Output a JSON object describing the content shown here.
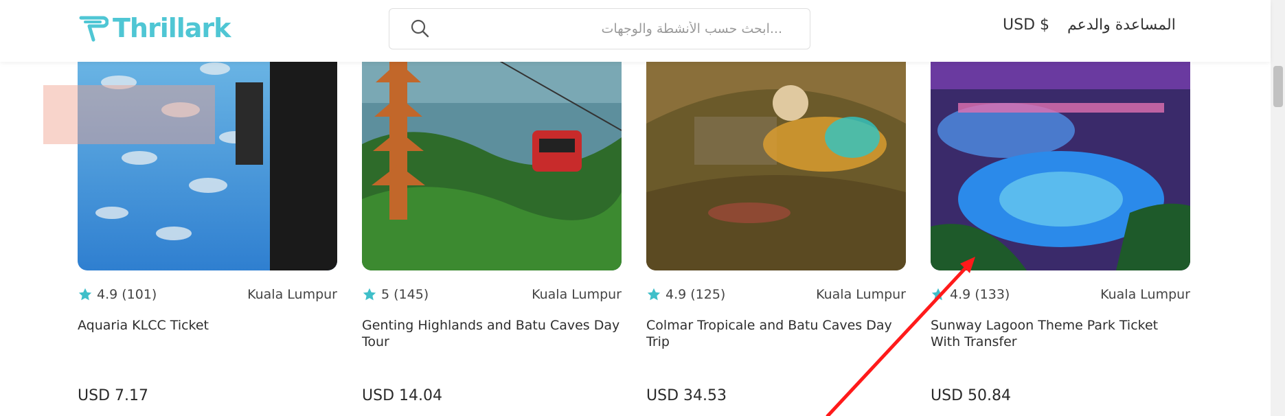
{
  "header": {
    "logo_text": "Thrillark",
    "search_placeholder": "...ابحث حسب الأنشطة والوجهات",
    "currency": "USD $",
    "help": "المساعدة والدعم"
  },
  "cards": [
    {
      "rating": "4.9 (101)",
      "location": "Kuala Lumpur",
      "title": "Aquaria KLCC Ticket",
      "price": "USD 7.17"
    },
    {
      "rating": "5 (145)",
      "location": "Kuala Lumpur",
      "title": "Genting Highlands and Batu Caves Day Tour",
      "price": "USD 14.04"
    },
    {
      "rating": "4.9 (125)",
      "location": "Kuala Lumpur",
      "title": "Colmar Tropicale and Batu Caves Day Trip",
      "price": "USD 34.53"
    },
    {
      "rating": "4.9 (133)",
      "location": "Kuala Lumpur",
      "title": "Sunway Lagoon Theme Park Ticket With Transfer",
      "price": "USD 50.84"
    }
  ],
  "colors": {
    "brand": "#4fc6d4",
    "star": "#3fbfc9",
    "annotation_arrow": "#ff1a1a"
  }
}
